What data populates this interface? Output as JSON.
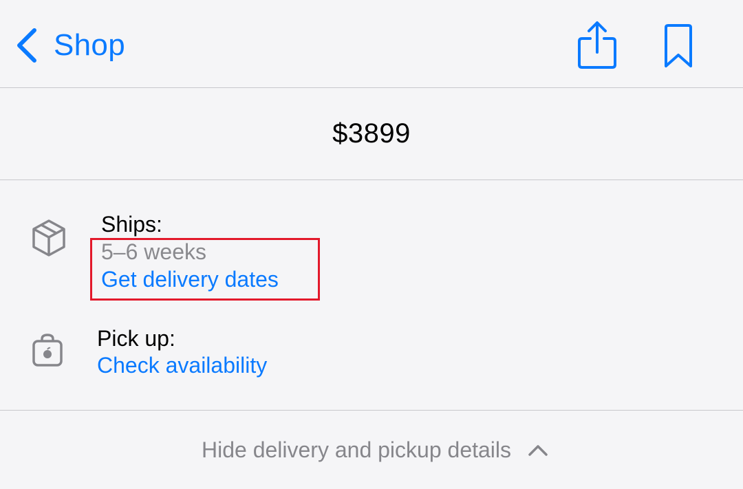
{
  "nav": {
    "back_label": "Shop",
    "share_icon": "share-icon",
    "bookmark_icon": "bookmark-icon"
  },
  "price": "$3899",
  "shipping": {
    "label": "Ships:",
    "time": "5–6 weeks",
    "link": "Get delivery dates",
    "icon": "box-icon"
  },
  "pickup": {
    "label": "Pick up:",
    "link": "Check availability",
    "icon": "bag-icon"
  },
  "toggle": {
    "label": "Hide delivery and pickup details",
    "icon": "chevron-up-icon"
  },
  "colors": {
    "accent": "#0a7aff",
    "secondary_text": "#8a8a8e",
    "highlight": "#e3192b",
    "background": "#f5f5f7"
  }
}
